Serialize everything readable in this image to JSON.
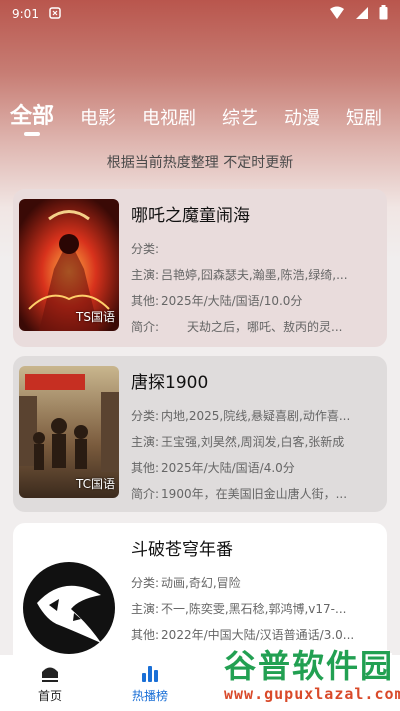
{
  "status_bar": {
    "time": "9:01"
  },
  "tabs": [
    {
      "label": "全部",
      "active": true
    },
    {
      "label": "电影",
      "active": false
    },
    {
      "label": "电视剧",
      "active": false
    },
    {
      "label": "综艺",
      "active": false
    },
    {
      "label": "动漫",
      "active": false
    },
    {
      "label": "短剧",
      "active": false
    }
  ],
  "subtitle": "根据当前热度整理 不定时更新",
  "items": [
    {
      "title": "哪吒之魔童闹海",
      "tag": "TS国语",
      "category_label": "分类:",
      "category": "",
      "cast_label": "主演:",
      "cast": "吕艳婷,囧森瑟夫,瀚墨,陈浩,绿绮,...",
      "other_label": "其他:",
      "other": "2025年/大陆/国语/10.0分",
      "intro_label": "简介:",
      "intro": "天劫之后，哪吒、敖丙的灵..."
    },
    {
      "title": "唐探1900",
      "tag": "TC国语",
      "category_label": "分类:",
      "category": "内地,2025,院线,悬疑喜剧,动作喜...",
      "cast_label": "主演:",
      "cast": "王宝强,刘昊然,周润发,白客,张新成",
      "other_label": "其他:",
      "other": "2025年/大陆/国语/4.0分",
      "intro_label": "简介:",
      "intro": "1900年，在美国旧金山唐人街，..."
    },
    {
      "title": "斗破苍穹年番",
      "tag": "",
      "category_label": "分类:",
      "category": "动画,奇幻,冒险",
      "cast_label": "主演:",
      "cast": "不一,陈奕雯,黑石稔,郭鸿博,v17-...",
      "other_label": "其他:",
      "other": "2022年/中国大陆/汉语普通话/3.0...",
      "intro_label": "简介:",
      "intro": ""
    }
  ],
  "bottom_nav": [
    {
      "label": "首页",
      "icon": "home-icon",
      "active": false
    },
    {
      "label": "热播榜",
      "icon": "bar-chart-icon",
      "active": true
    }
  ],
  "watermark": {
    "main": "谷普软件园",
    "sub": "www.gupuxlazal.com"
  },
  "colors": {
    "accent": "#1a6fd6",
    "watermark_green": "#22a052",
    "watermark_red": "#d94a2a"
  }
}
